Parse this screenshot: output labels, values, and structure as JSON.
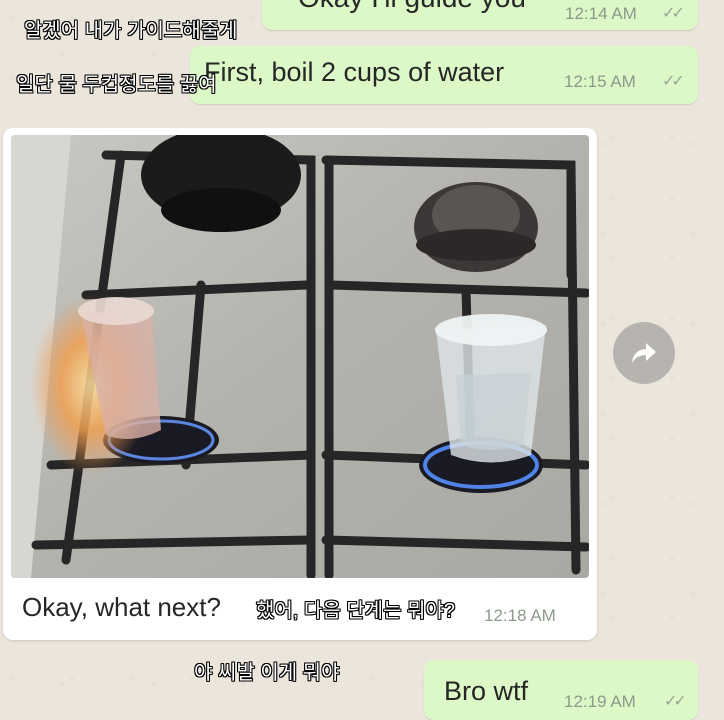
{
  "overlays": {
    "line1": "알겠어 내가 가이드해줄게",
    "line2": "일단 물 두컵정도를 끓여",
    "line3": "했어, 다음 단계는 뭐야?",
    "line4": "야 씨발 이게 뭐야"
  },
  "messages": [
    {
      "direction": "outgoing",
      "text": "Okay I'll guide you",
      "time": "12:14 AM"
    },
    {
      "direction": "outgoing",
      "text": "First, boil 2 cups of water",
      "time": "12:15 AM"
    },
    {
      "direction": "incoming",
      "text": "Okay, what next?",
      "time": "12:18 AM",
      "has_image": true
    },
    {
      "direction": "outgoing",
      "text": "Bro wtf",
      "time": "12:19 AM"
    }
  ],
  "icons": {
    "read_ticks": "double-check-icon",
    "forward": "forward-arrow-icon"
  },
  "colors": {
    "chat_background": "#ece5dc",
    "outgoing_bubble": "#dcf8c6",
    "incoming_bubble": "#ffffff"
  }
}
